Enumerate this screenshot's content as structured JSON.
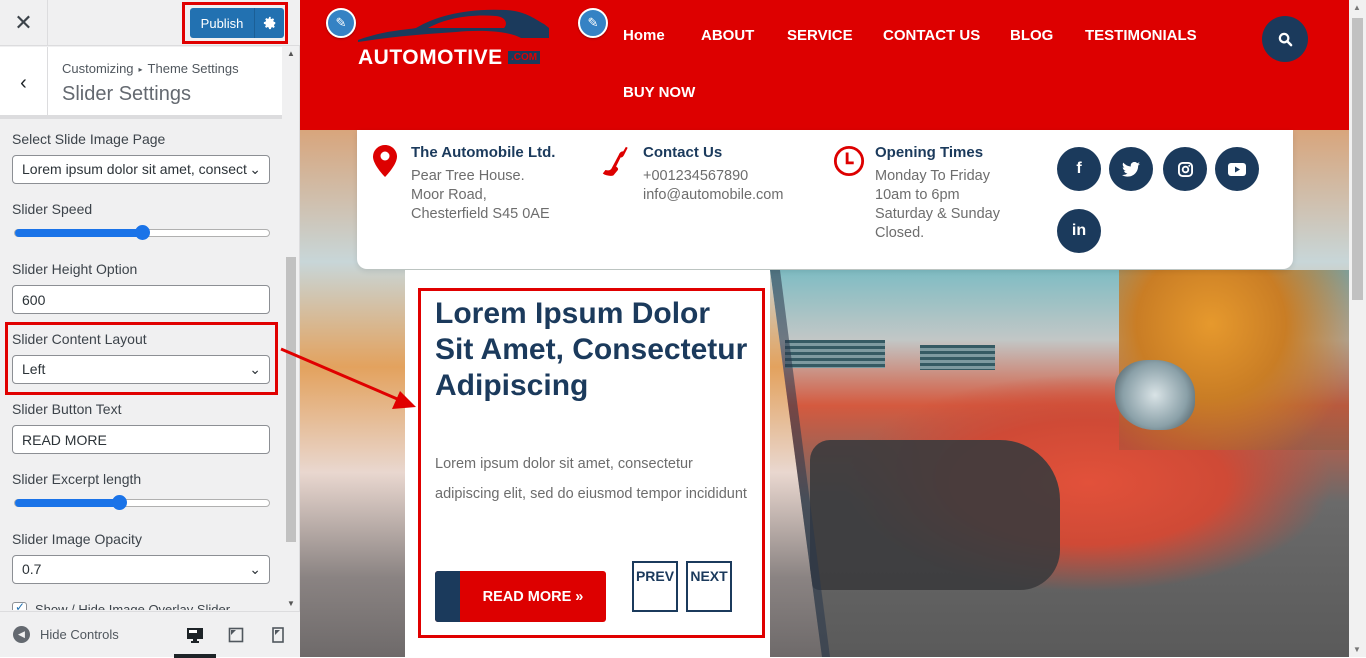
{
  "customizer": {
    "close_icon": "close-icon",
    "publish_label": "Publish",
    "publish_settings_icon": "gear-icon",
    "breadcrumb": [
      "Customizing",
      "Theme Settings"
    ],
    "breadcrumb_separator": "▸",
    "section_title": "Slider Settings",
    "controls": {
      "slide_image_page": {
        "label": "Select Slide Image Page",
        "value": "Lorem ipsum dolor sit amet, consect"
      },
      "slider_speed": {
        "label": "Slider Speed",
        "value_fraction": 0.5
      },
      "slider_height": {
        "label": "Slider Height Option",
        "value": "600"
      },
      "content_layout": {
        "label": "Slider Content Layout",
        "value": "Left"
      },
      "button_text": {
        "label": "Slider Button Text",
        "value": "READ MORE"
      },
      "excerpt_length": {
        "label": "Slider Excerpt length",
        "value_fraction": 0.41
      },
      "image_opacity": {
        "label": "Slider Image Opacity",
        "value": "0.7"
      },
      "overlay_checkbox": {
        "label": "Show / Hide Image Overlay Slider",
        "checked": true
      }
    },
    "footer": {
      "hide_controls_label": "Hide Controls",
      "devices": [
        "desktop",
        "tablet",
        "mobile"
      ],
      "active_device": "desktop"
    }
  },
  "preview": {
    "brand": {
      "name": "AUTOMOTIVE",
      "suffix": ".COM"
    },
    "nav": [
      "Home",
      "ABOUT",
      "SERVICE",
      "CONTACT US",
      "BLOG",
      "TESTIMONIALS",
      "BUY NOW"
    ],
    "info": {
      "address": {
        "title": "The Automobile Ltd.",
        "lines": [
          "Pear Tree House.",
          "Moor Road,",
          "Chesterfield S45 0AE"
        ]
      },
      "contact": {
        "title": "Contact Us",
        "lines": [
          "+001234567890",
          "info@automobile.com"
        ]
      },
      "hours": {
        "title": "Opening Times",
        "lines": [
          "Monday To Friday",
          "10am to 6pm",
          "Saturday & Sunday",
          "Closed."
        ]
      }
    },
    "social": [
      "facebook",
      "twitter",
      "instagram",
      "youtube",
      "linkedin"
    ],
    "slide": {
      "title": "Lorem Ipsum Dolor Sit Amet, Consectetur Adipiscing",
      "excerpt": "Lorem ipsum dolor sit amet, consectetur adipiscing elit, sed do eiusmod tempor incididunt",
      "button_label": "READ MORE »",
      "prev_label": "PREV",
      "next_label": "NEXT"
    },
    "colors": {
      "primary_red": "#dd0000",
      "navy": "#1b3a5c",
      "wp_blue": "#2271b1",
      "highlight": "#e00000"
    }
  }
}
